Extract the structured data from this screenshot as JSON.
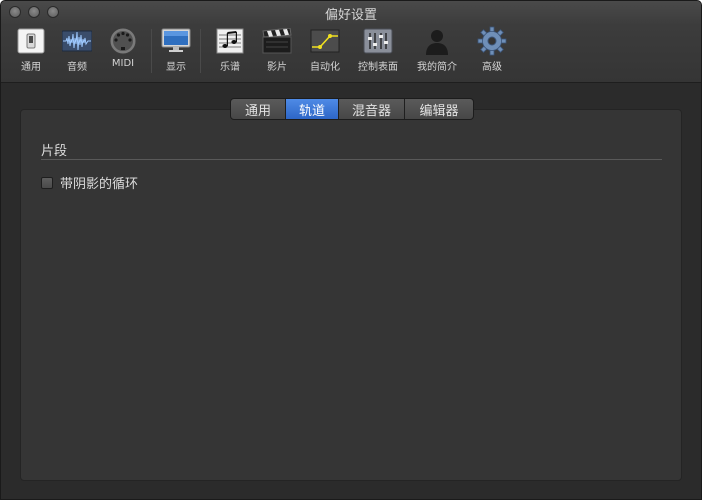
{
  "window": {
    "title": "偏好设置"
  },
  "toolbar": [
    {
      "label": "通用",
      "icon": "general-switch-icon"
    },
    {
      "label": "音频",
      "icon": "audio-waveform-icon"
    },
    {
      "label": "MIDI",
      "icon": "midi-connector-icon"
    },
    {
      "label": "显示",
      "icon": "display-monitor-icon"
    },
    {
      "label": "乐谱",
      "icon": "score-notes-icon"
    },
    {
      "label": "影片",
      "icon": "movie-clapper-icon"
    },
    {
      "label": "自动化",
      "icon": "automation-curve-icon"
    },
    {
      "label": "控制表面",
      "icon": "control-surface-faders-icon"
    },
    {
      "label": "我的简介",
      "icon": "user-silhouette-icon"
    },
    {
      "label": "高级",
      "icon": "gear-icon"
    }
  ],
  "tabs": [
    {
      "label": "通用",
      "active": false
    },
    {
      "label": "轨道",
      "active": true
    },
    {
      "label": "混音器",
      "active": false
    },
    {
      "label": "编辑器",
      "active": false
    }
  ],
  "panel": {
    "group_title": "片段",
    "checkbox_label": "带阴影的循环",
    "checkbox_checked": false
  },
  "colors": {
    "accent": "#3a78d8",
    "background": "#2b2b2b",
    "panel": "#353535"
  }
}
